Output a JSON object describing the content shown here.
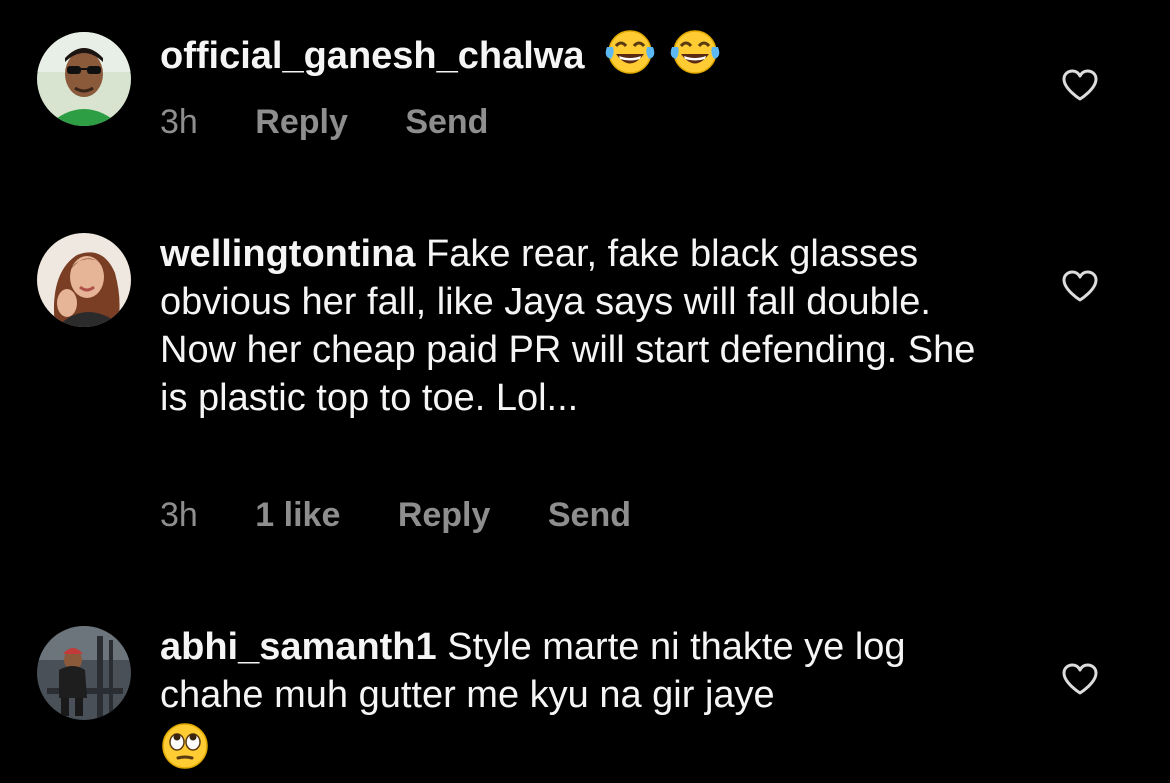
{
  "comments": [
    {
      "username": "official_ganesh_chalwa",
      "text": "",
      "emojis": [
        "face-with-tears-of-joy",
        "face-with-tears-of-joy"
      ],
      "time": "3h",
      "likes": "",
      "reply": "Reply",
      "send": "Send"
    },
    {
      "username": "wellingtontina",
      "text": "Fake rear, fake black glasses obvious her fall, like Jaya says will fall double. Now her cheap paid PR will start defending. She is plastic top to toe. Lol...",
      "time": "3h",
      "likes": "1 like",
      "reply": "Reply",
      "send": "Send"
    },
    {
      "username": "abhi_samanth1",
      "text": "Style marte ni thakte ye log chahe muh gutter me kyu na gir jaye",
      "emojis": [
        "face-with-rolling-eyes"
      ],
      "time": "",
      "likes": "",
      "reply": "",
      "send": ""
    }
  ],
  "colors": {
    "background": "#000000",
    "text": "#f5f5f5",
    "muted": "#8e8e8e"
  },
  "icons": {
    "like": "heart-outline-icon"
  }
}
